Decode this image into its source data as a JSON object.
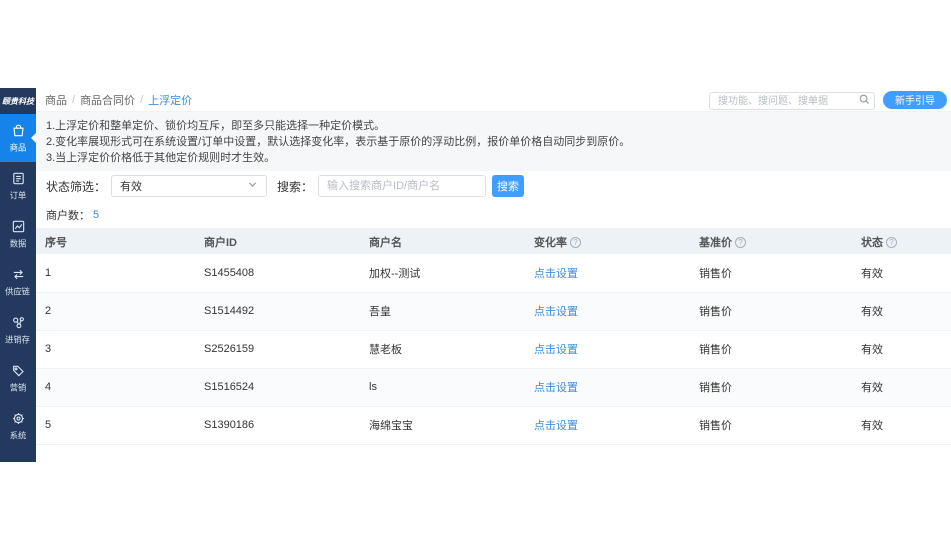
{
  "colors": {
    "sidebar_bg": "#24395e",
    "sidebar_active_bg": "#1583e9",
    "accent_blue": "#409eff",
    "link_blue": "#3d8ddd",
    "table_header_bg": "#eef1f6",
    "notice_bg": "#f5f7f9"
  },
  "sidebar": {
    "logo": "颐贵科技",
    "items": [
      {
        "label": "商品",
        "icon": "shopping-bag-icon",
        "active": true
      },
      {
        "label": "订单",
        "icon": "order-doc-icon",
        "active": false
      },
      {
        "label": "数据",
        "icon": "line-chart-icon",
        "active": false
      },
      {
        "label": "供应链",
        "icon": "supply-arrows-icon",
        "active": false
      },
      {
        "label": "进销存",
        "icon": "network-nodes-icon",
        "active": false
      },
      {
        "label": "营销",
        "icon": "price-tag-icon",
        "active": false
      },
      {
        "label": "系统",
        "icon": "gear-icon",
        "active": false
      }
    ]
  },
  "header": {
    "breadcrumb": [
      "商品",
      "商品合同价",
      "上浮定价"
    ],
    "separator": "/",
    "search_placeholder": "搜功能、搜问题、搜单据",
    "guide_button": "新手引导"
  },
  "notice": {
    "lines": [
      "1.上浮定价和整单定价、锁价均互斥，即至多只能选择一种定价模式。",
      "2.变化率展现形式可在系统设置/订单中设置，默认选择变化率，表示基于原价的浮动比例，报价单价格自动同步到原价。",
      "3.当上浮定价价格低于其他定价规则时才生效。"
    ]
  },
  "filters": {
    "status_label": "状态筛选：",
    "status_value": "有效",
    "search_label": "搜索：",
    "search_placeholder": "输入搜索商户ID/商户名",
    "search_button": "搜索"
  },
  "summary": {
    "merchant_count_label": "商户数：",
    "merchant_count": "5"
  },
  "table": {
    "help_glyph": "?",
    "columns": [
      {
        "label": "序号",
        "help": false
      },
      {
        "label": "商户ID",
        "help": false
      },
      {
        "label": "商户名",
        "help": false
      },
      {
        "label": "变化率",
        "help": true
      },
      {
        "label": "基准价",
        "help": true
      },
      {
        "label": "状态",
        "help": true
      }
    ],
    "rows": [
      {
        "index": "1",
        "merchant_id": "S1455408",
        "merchant_name": "加权--测试",
        "change_rate": "点击设置",
        "base_price": "销售价",
        "status": "有效"
      },
      {
        "index": "2",
        "merchant_id": "S1514492",
        "merchant_name": "吾皇",
        "change_rate": "点击设置",
        "base_price": "销售价",
        "status": "有效"
      },
      {
        "index": "3",
        "merchant_id": "S2526159",
        "merchant_name": "慧老板",
        "change_rate": "点击设置",
        "base_price": "销售价",
        "status": "有效"
      },
      {
        "index": "4",
        "merchant_id": "S1516524",
        "merchant_name": "ls",
        "change_rate": "点击设置",
        "base_price": "销售价",
        "status": "有效"
      },
      {
        "index": "5",
        "merchant_id": "S1390186",
        "merchant_name": "海绵宝宝",
        "change_rate": "点击设置",
        "base_price": "销售价",
        "status": "有效"
      }
    ]
  }
}
